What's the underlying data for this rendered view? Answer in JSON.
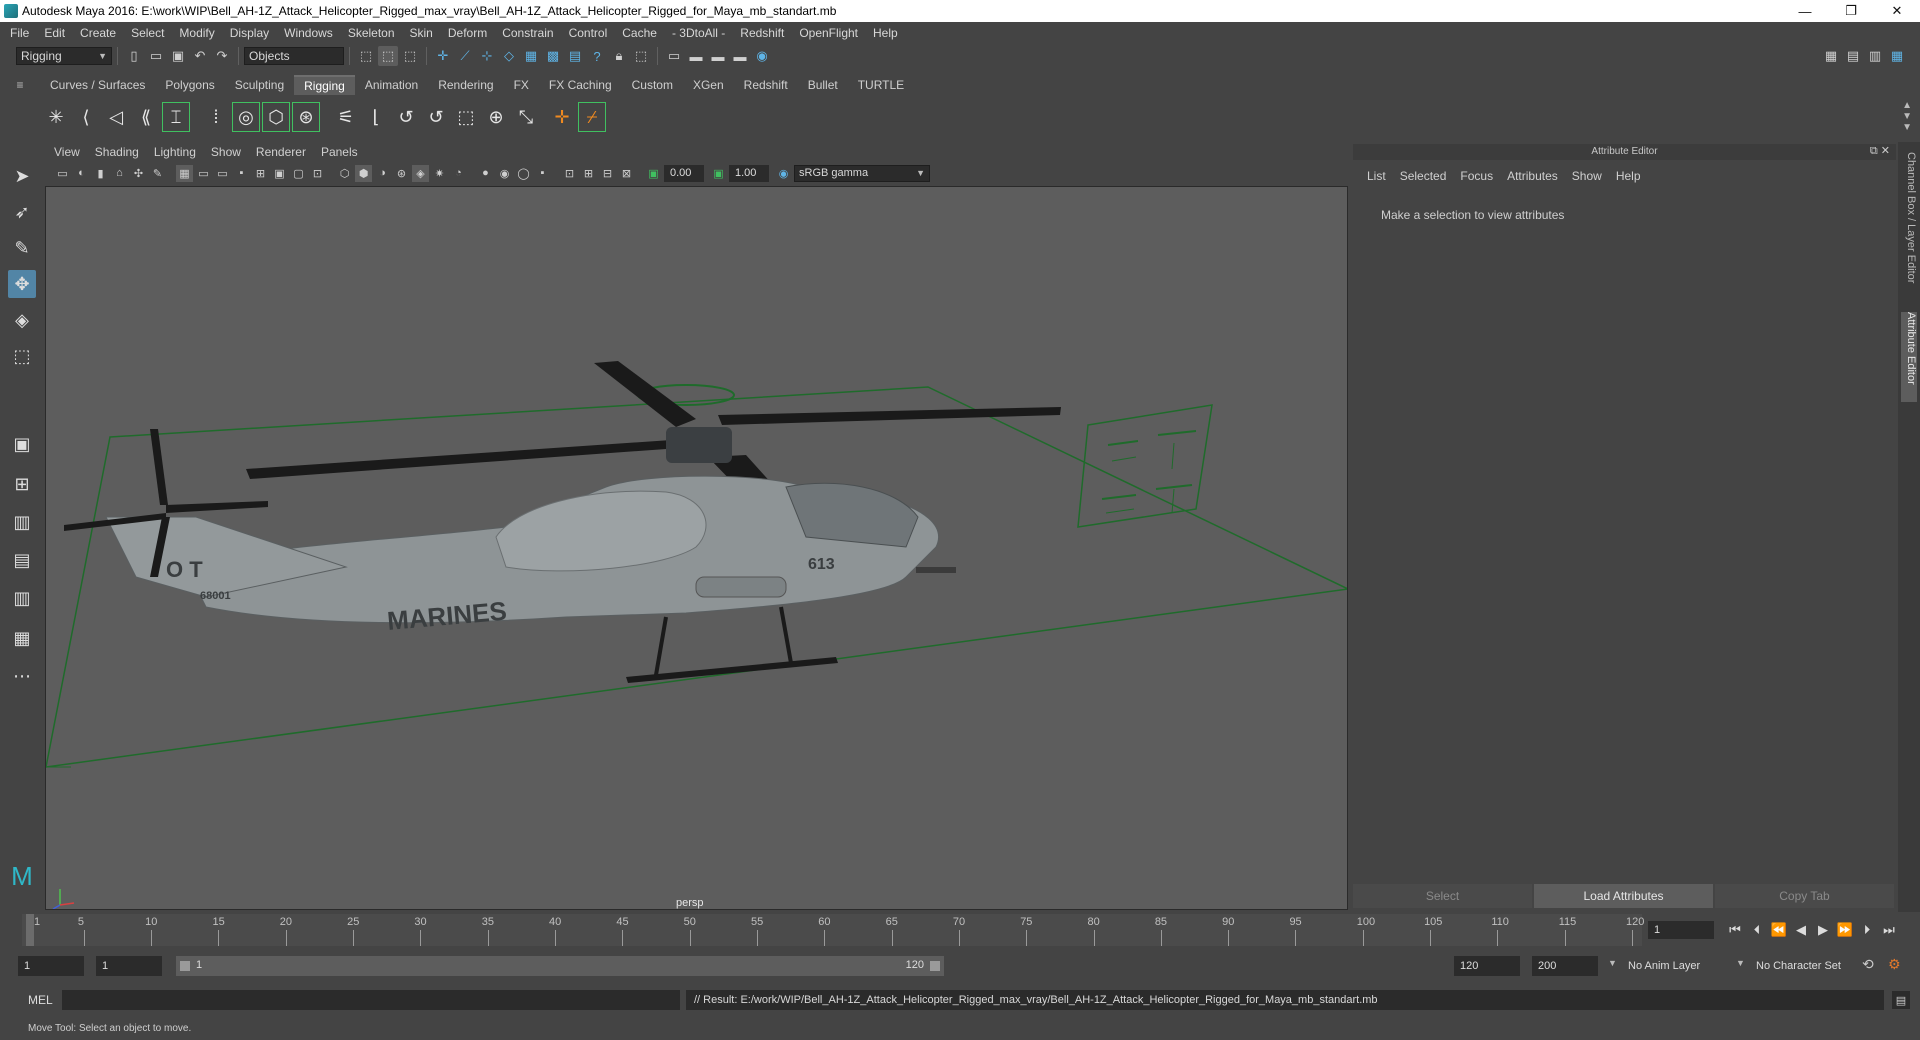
{
  "window": {
    "title": "Autodesk Maya 2016: E:\\work\\WIP\\Bell_AH-1Z_Attack_Helicopter_Rigged_max_vray\\Bell_AH-1Z_Attack_Helicopter_Rigged_for_Maya_mb_standart.mb",
    "minimize": "—",
    "restore": "❐",
    "close": "✕"
  },
  "menubar": [
    "File",
    "Edit",
    "Create",
    "Select",
    "Modify",
    "Display",
    "Windows",
    "Skeleton",
    "Skin",
    "Deform",
    "Constrain",
    "Control",
    "Cache",
    "- 3DtoAll -",
    "Redshift",
    "OpenFlight",
    "Help"
  ],
  "statusline": {
    "menuset": "Rigging",
    "selection_mode": "Objects"
  },
  "shelf": {
    "tabs": [
      "Curves / Surfaces",
      "Polygons",
      "Sculpting",
      "Rigging",
      "Animation",
      "Rendering",
      "FX",
      "FX Caching",
      "Custom",
      "XGen",
      "Redshift",
      "Bullet",
      "TURTLE"
    ],
    "active_tab": "Rigging"
  },
  "viewport": {
    "menus": [
      "View",
      "Shading",
      "Lighting",
      "Show",
      "Renderer",
      "Panels"
    ],
    "exposure": "0.00",
    "gamma": "1.00",
    "colorspace": "sRGB gamma",
    "camera": "persp",
    "decal_text": "MARINES",
    "tail_text": "O T",
    "tail_number": "68001",
    "fuselage_number": "613"
  },
  "attribute_editor": {
    "title": "Attribute Editor",
    "menu": [
      "List",
      "Selected",
      "Focus",
      "Attributes",
      "Show",
      "Help"
    ],
    "message": "Make a selection to view attributes",
    "buttons": [
      "Select",
      "Load Attributes",
      "Copy Tab"
    ]
  },
  "side_tabs": [
    "Channel Box / Layer Editor",
    "Attribute Editor"
  ],
  "timeslider": {
    "ticks": [
      "1",
      "5",
      "10",
      "15",
      "20",
      "25",
      "30",
      "35",
      "40",
      "45",
      "50",
      "55",
      "60",
      "65",
      "70",
      "75",
      "80",
      "85",
      "90",
      "95",
      "100",
      "105",
      "110",
      "115",
      "120"
    ],
    "current_frame": "1"
  },
  "range": {
    "start": "1",
    "playback_start": "1",
    "slider_start": "1",
    "slider_end": "120",
    "playback_end": "120",
    "end": "200",
    "anim_layer": "No Anim Layer",
    "character_set": "No Character Set"
  },
  "commandline": {
    "label": "MEL",
    "result": "// Result: E:/work/WIP/Bell_AH-1Z_Attack_Helicopter_Rigged_max_vray/Bell_AH-1Z_Attack_Helicopter_Rigged_for_Maya_mb_standart.mb"
  },
  "helpline": "Move Tool: Select an object to move."
}
